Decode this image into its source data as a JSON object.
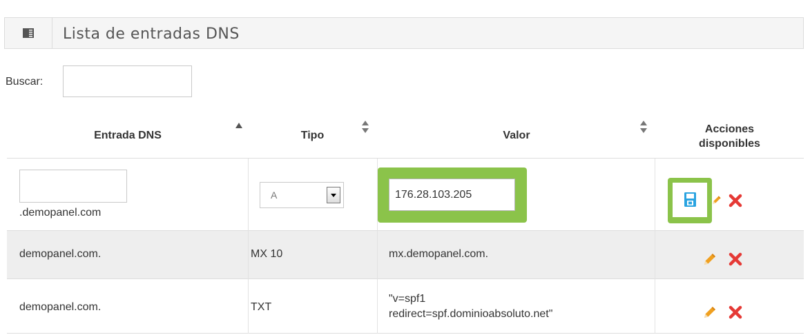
{
  "panel": {
    "title": "Lista de entradas DNS",
    "icon": "list-panel-icon"
  },
  "search": {
    "label": "Buscar:",
    "value": ""
  },
  "table": {
    "columns": [
      "Entrada DNS",
      "Tipo",
      "Valor",
      "Acciones disponibles"
    ],
    "acciones_line1": "Acciones",
    "acciones_line2": "disponibles",
    "edit_row": {
      "entry_value": "",
      "domain_suffix": ".demopanel.com",
      "type_selected": "A",
      "value": "176.28.103.205"
    },
    "rows": [
      {
        "entry": "demopanel.com.",
        "type": "MX 10",
        "value_line1": "mx.demopanel.com.",
        "value_line2": ""
      },
      {
        "entry": "demopanel.com.",
        "type": "TXT",
        "value_line1": "\"v=spf1",
        "value_line2": "redirect=spf.dominioabsoluto.net\""
      }
    ]
  },
  "colors": {
    "highlight": "#8bc34a",
    "save_icon": "#29a3e0",
    "pencil": "#f0a020",
    "delete": "#e53935",
    "alt_row": "#eeeeee"
  }
}
